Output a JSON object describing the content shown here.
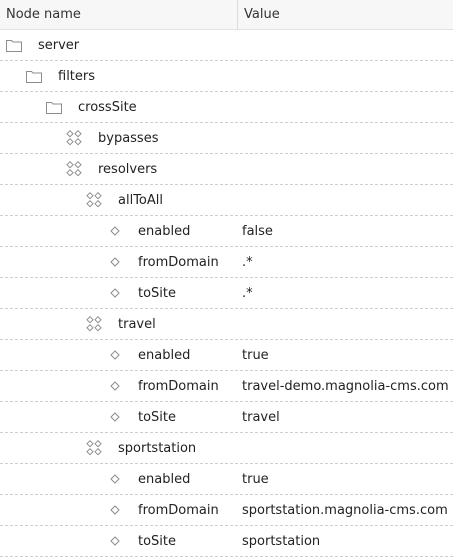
{
  "header": {
    "node_name": "Node name",
    "value": "Value"
  },
  "rows": [
    {
      "label": "server",
      "value": "",
      "icon": "folder-icon",
      "level": 0
    },
    {
      "label": "filters",
      "value": "",
      "icon": "folder-icon",
      "level": 1
    },
    {
      "label": "crossSite",
      "value": "",
      "icon": "folder-icon",
      "level": 2
    },
    {
      "label": "bypasses",
      "value": "",
      "icon": "content-node-icon",
      "level": 3
    },
    {
      "label": "resolvers",
      "value": "",
      "icon": "content-node-icon",
      "level": 3
    },
    {
      "label": "allToAll",
      "value": "",
      "icon": "content-node-icon",
      "level": 4
    },
    {
      "label": "enabled",
      "value": "false",
      "icon": "property-icon",
      "level": 5
    },
    {
      "label": "fromDomain",
      "value": ".*",
      "icon": "property-icon",
      "level": 5
    },
    {
      "label": "toSite",
      "value": ".*",
      "icon": "property-icon",
      "level": 5
    },
    {
      "label": "travel",
      "value": "",
      "icon": "content-node-icon",
      "level": 4
    },
    {
      "label": "enabled",
      "value": "true",
      "icon": "property-icon",
      "level": 5
    },
    {
      "label": "fromDomain",
      "value": "travel-demo.magnolia-cms.com",
      "icon": "property-icon",
      "level": 5
    },
    {
      "label": "toSite",
      "value": "travel",
      "icon": "property-icon",
      "level": 5
    },
    {
      "label": "sportstation",
      "value": "",
      "icon": "content-node-icon",
      "level": 4
    },
    {
      "label": "enabled",
      "value": "true",
      "icon": "property-icon",
      "level": 5
    },
    {
      "label": "fromDomain",
      "value": "sportstation.magnolia-cms.com",
      "icon": "property-icon",
      "level": 5
    },
    {
      "label": "toSite",
      "value": "sportstation",
      "icon": "property-icon",
      "level": 5
    }
  ]
}
